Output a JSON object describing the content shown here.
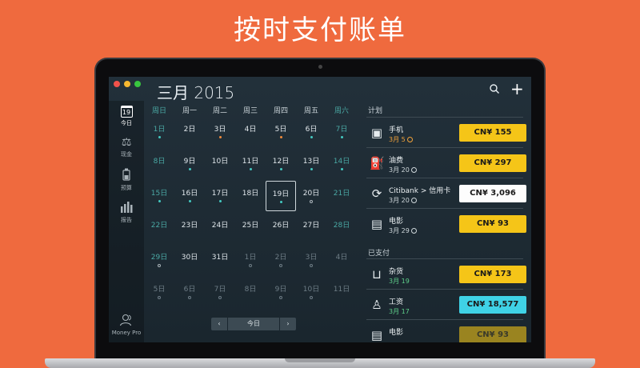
{
  "headline": "按时支付账单",
  "window": {
    "title": "三月 2015"
  },
  "sidebar": {
    "items": [
      {
        "label": "今日",
        "icon": "calendar-icon",
        "badge": "19"
      },
      {
        "label": "现金",
        "icon": "scales-icon"
      },
      {
        "label": "预算",
        "icon": "budget-jar-icon"
      },
      {
        "label": "报告",
        "icon": "bar-chart-icon"
      }
    ],
    "footer": "Money Pro"
  },
  "calendar": {
    "weekdays": [
      "周日",
      "周一",
      "周二",
      "周三",
      "周四",
      "周五",
      "周六"
    ],
    "weeks": [
      [
        {
          "d": "1日",
          "dot": "teal"
        },
        {
          "d": "2日"
        },
        {
          "d": "3日",
          "dot": "orange"
        },
        {
          "d": "4日"
        },
        {
          "d": "5日",
          "dot": "orange"
        },
        {
          "d": "6日",
          "dot": "teal"
        },
        {
          "d": "7日",
          "dot": "teal"
        }
      ],
      [
        {
          "d": "8日"
        },
        {
          "d": "9日",
          "dot": "teal"
        },
        {
          "d": "10日"
        },
        {
          "d": "11日",
          "dot": "teal"
        },
        {
          "d": "12日",
          "dot": "teal"
        },
        {
          "d": "13日",
          "dot": "teal"
        },
        {
          "d": "14日",
          "dot": "teal"
        }
      ],
      [
        {
          "d": "15日",
          "dot": "teal"
        },
        {
          "d": "16日",
          "dot": "teal"
        },
        {
          "d": "17日",
          "dot": "teal"
        },
        {
          "d": "18日"
        },
        {
          "d": "19日",
          "dot": "teal",
          "selected": true
        },
        {
          "d": "20日",
          "dot": "ring"
        },
        {
          "d": "21日"
        }
      ],
      [
        {
          "d": "22日"
        },
        {
          "d": "23日"
        },
        {
          "d": "24日"
        },
        {
          "d": "25日"
        },
        {
          "d": "26日"
        },
        {
          "d": "27日"
        },
        {
          "d": "28日"
        }
      ],
      [
        {
          "d": "29日",
          "dot": "ring"
        },
        {
          "d": "30日"
        },
        {
          "d": "31日"
        },
        {
          "d": "1日",
          "muted": true,
          "dot": "ring-dim"
        },
        {
          "d": "2日",
          "muted": true,
          "dot": "ring-dim"
        },
        {
          "d": "3日",
          "muted": true,
          "dot": "ring-dim"
        },
        {
          "d": "4日",
          "muted": true
        }
      ],
      [
        {
          "d": "5日",
          "muted": true,
          "dot": "ring-dim"
        },
        {
          "d": "6日",
          "muted": true,
          "dot": "ring-dim"
        },
        {
          "d": "7日",
          "muted": true,
          "dot": "ring-dim"
        },
        {
          "d": "8日",
          "muted": true
        },
        {
          "d": "9日",
          "muted": true,
          "dot": "ring-dim"
        },
        {
          "d": "10日",
          "muted": true,
          "dot": "ring-dim"
        },
        {
          "d": "11日",
          "muted": true
        }
      ]
    ],
    "nav": {
      "prev": "‹",
      "today": "今日",
      "next": "›"
    }
  },
  "panel": {
    "planned_title": "计划",
    "paid_title": "已支付",
    "planned": [
      {
        "name": "手机",
        "date": "3月 5",
        "overdue": true,
        "amount": "CN¥ 155",
        "style": "yellow",
        "icon": "sim-card-icon"
      },
      {
        "name": "油费",
        "date": "3月 20",
        "overdue": true,
        "amount": "CN¥ 297",
        "style": "yellow",
        "icon": "fuel-pump-icon"
      },
      {
        "name": "Citibank > 信用卡",
        "date": "3月 20",
        "overdue": true,
        "amount": "CN¥ 3,096",
        "style": "white",
        "icon": "transfer-icon"
      },
      {
        "name": "电影",
        "date": "3月 29",
        "overdue": true,
        "amount": "CN¥ 93",
        "style": "yellow",
        "icon": "film-icon"
      }
    ],
    "paid": [
      {
        "name": "杂货",
        "date": "3月 19",
        "amount": "CN¥ 173",
        "style": "yellow",
        "icon": "basket-icon"
      },
      {
        "name": "工资",
        "date": "3月 17",
        "amount": "CN¥ 18,577",
        "style": "cyan",
        "icon": "person-icon"
      },
      {
        "name": "电影",
        "date": "",
        "amount": "CN¥ 93",
        "style": "dim",
        "icon": "film-icon"
      }
    ]
  },
  "colors": {
    "background": "#ef6a3e",
    "accent_teal": "#44c9c1",
    "amount_yellow": "#f5c518",
    "amount_cyan": "#3fd2e6"
  }
}
